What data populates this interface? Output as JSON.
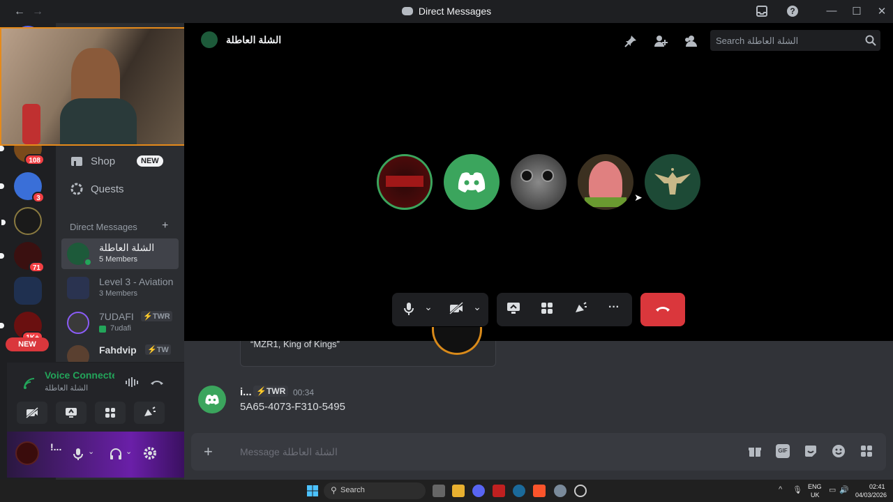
{
  "window": {
    "title": "Direct Messages"
  },
  "rail": {
    "servers": [
      {
        "badge": "108",
        "color": "#7a4a1a"
      },
      {
        "badge": "3",
        "color": "#3a6fd8"
      },
      {
        "badge": "",
        "color": "#1a1a1a"
      },
      {
        "badge": "71",
        "color": "#3a1010"
      },
      {
        "badge": "",
        "color": "#1f3050"
      },
      {
        "badge": "1K+",
        "color": "#6a1010"
      }
    ],
    "new_pill": "NEW"
  },
  "sidebar": {
    "shop_label": "Shop",
    "shop_badge": "NEW",
    "quests_label": "Quests",
    "dm_header": "Direct Messages",
    "dms": [
      {
        "name": "الشلة العاطلة",
        "sub": "5 Members",
        "active": true
      },
      {
        "name": "Level 3 - Aviation",
        "sub": "3 Members",
        "active": false
      },
      {
        "name": "7UDAFI",
        "tag": "⚡TWR",
        "sub": "7udafi",
        "active": false
      },
      {
        "name": "Fahdvip",
        "tag": "⚡TW",
        "sub": "",
        "active": false
      }
    ],
    "voice": {
      "status": "Voice Connected",
      "channel": "الشلة العاطلة"
    },
    "user": {
      "name": "!..."
    }
  },
  "call": {
    "header_title": "الشلة العاطلة",
    "search_placeholder": "Search الشلة العاطلة",
    "participants": [
      {
        "name": "thug-life",
        "color": "#5a0c0c"
      },
      {
        "name": "discord-default",
        "color": "#3ba55d"
      },
      {
        "name": "cockpit",
        "color": "#4a4a4a"
      },
      {
        "name": "patrick",
        "color": "#c96a6a"
      },
      {
        "name": "eagle",
        "color": "#1d4a36"
      }
    ]
  },
  "chat": {
    "quote": "“MZR1, King of Kings”",
    "message": {
      "author": "i...",
      "tag": "⚡TWR",
      "time": "00:34",
      "text": "5A65-4073-F310-5495"
    },
    "input_placeholder": "Message الشلة العاطلة"
  },
  "taskbar": {
    "search": "Search",
    "lang": "ENG",
    "region": "UK",
    "time": "02:41",
    "date": "04/03/2026"
  },
  "colors": {
    "accent": "#5865f2",
    "green": "#3ba55d",
    "danger": "#da373c",
    "bg": "#1e1f22"
  }
}
